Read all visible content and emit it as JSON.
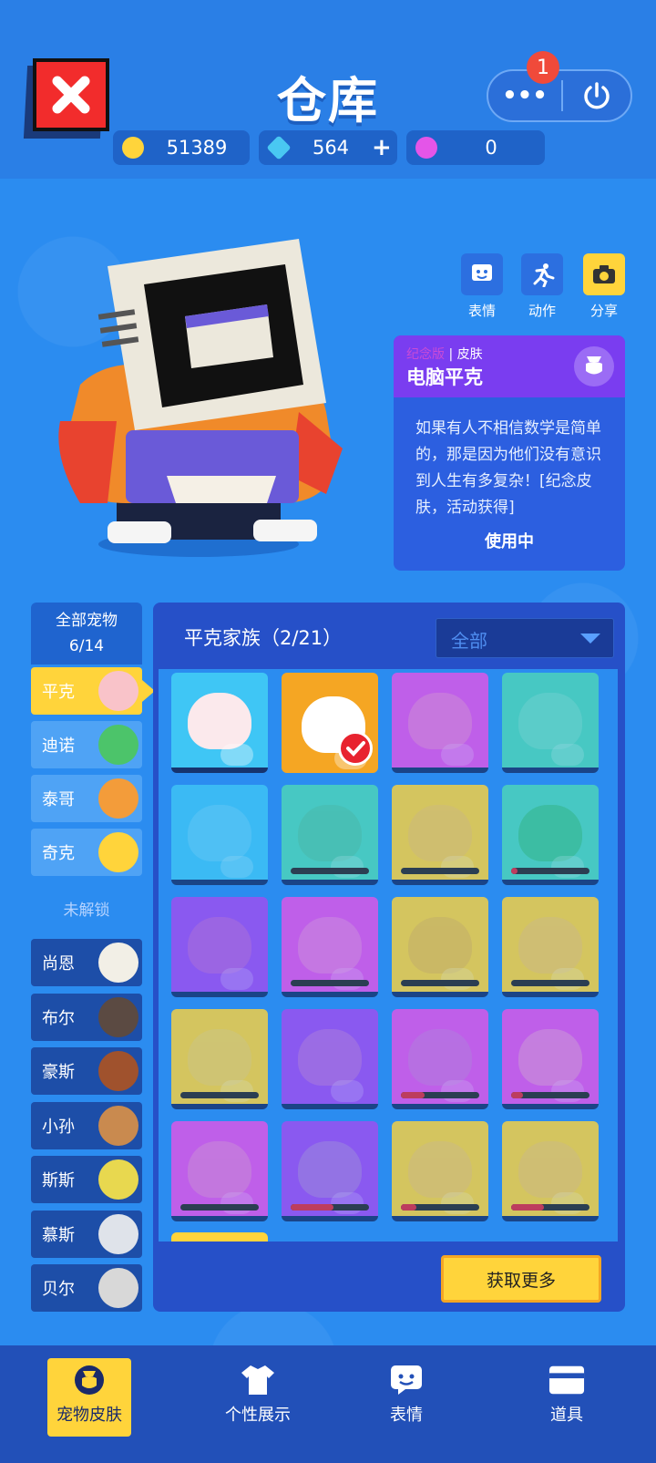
{
  "header": {
    "title": "仓库",
    "notification_count": "1",
    "more_label": "•••"
  },
  "resources": {
    "coins": "51389",
    "diamonds": "564",
    "diamonds_add": "+",
    "tokens": "0"
  },
  "actions": [
    {
      "label": "表情",
      "icon": "emoji-icon"
    },
    {
      "label": "动作",
      "icon": "action-icon"
    },
    {
      "label": "分享",
      "icon": "camera-icon"
    }
  ],
  "skin_info": {
    "rarity": "纪念版",
    "separator": "|",
    "category": "皮肤",
    "name": "电脑平克",
    "description": "如果有人不相信数学是简单的，那是因为他们没有意识到人生有多复杂！[纪念皮肤，活动获得]",
    "status": "使用中"
  },
  "pets": {
    "header_label": "全部宠物",
    "header_count": "6/14",
    "owned": [
      {
        "name": "平克",
        "color": "#ffd43b",
        "face": "#f9c3c9",
        "selected": true
      },
      {
        "name": "迪诺",
        "color": "#4fa3f5",
        "face": "#4cc46a",
        "selected": false
      },
      {
        "name": "泰哥",
        "color": "#4fa3f5",
        "face": "#f39c3a",
        "selected": false
      },
      {
        "name": "奇克",
        "color": "#4fa3f5",
        "face": "#ffd43b",
        "selected": false
      }
    ],
    "locked_label": "未解锁",
    "locked": [
      {
        "name": "尚恩",
        "face": "#f2efe6"
      },
      {
        "name": "布尔",
        "face": "#5b4a42"
      },
      {
        "name": "豪斯",
        "face": "#a0522d"
      },
      {
        "name": "小孙",
        "face": "#c98a4f"
      },
      {
        "name": "斯斯",
        "face": "#e8d84f"
      },
      {
        "name": "慕斯",
        "face": "#dfe3ea"
      },
      {
        "name": "贝尔",
        "face": "#d8d8d8"
      }
    ]
  },
  "grid": {
    "title": "平克家族（2/21）",
    "filter": "全部",
    "get_more": "获取更多",
    "skins": [
      {
        "bg": "#3fc6f5",
        "pig": "#fbe9ec",
        "owned": true,
        "selected": false,
        "progress": null
      },
      {
        "bg": "#f5a623",
        "pig": "#ffffff",
        "owned": true,
        "selected": true,
        "progress": null
      },
      {
        "bg": "#e455e8",
        "pig": "#f58bd0",
        "owned": false,
        "selected": false,
        "progress": null
      },
      {
        "bg": "#4fd8b8",
        "pig": "#7ee0c8",
        "owned": false,
        "selected": false,
        "progress": null
      },
      {
        "bg": "#3fc6f5",
        "pig": "#6fd6f5",
        "owned": false,
        "selected": false,
        "progress": null
      },
      {
        "bg": "#4fd8b8",
        "pig": "#52c49a",
        "owned": false,
        "selected": false,
        "progress": 0
      },
      {
        "bg": "#ffd43b",
        "pig": "#f5c462",
        "owned": false,
        "selected": false,
        "progress": 0
      },
      {
        "bg": "#4fd8b8",
        "pig": "#36c070",
        "owned": false,
        "selected": false,
        "progress": 0.08
      },
      {
        "bg": "#a24df0",
        "pig": "#c96ad6",
        "owned": false,
        "selected": false,
        "progress": null
      },
      {
        "bg": "#e455e8",
        "pig": "#f38bd8",
        "owned": false,
        "selected": false,
        "progress": 0
      },
      {
        "bg": "#ffd43b",
        "pig": "#e8b84a",
        "owned": false,
        "selected": false,
        "progress": 0
      },
      {
        "bg": "#ffd43b",
        "pig": "#f3c46a",
        "owned": false,
        "selected": false,
        "progress": 0
      },
      {
        "bg": "#ffd43b",
        "pig": "#f3d36a",
        "owned": false,
        "selected": false,
        "progress": 0
      },
      {
        "bg": "#a24df0",
        "pig": "#c97ad8",
        "owned": false,
        "selected": false,
        "progress": null
      },
      {
        "bg": "#e455e8",
        "pig": "#d37ad8",
        "owned": false,
        "selected": false,
        "progress": 0.3
      },
      {
        "bg": "#e455e8",
        "pig": "#f39ad0",
        "owned": false,
        "selected": false,
        "progress": 0.15
      },
      {
        "bg": "#e455e8",
        "pig": "#f08bd0",
        "owned": false,
        "selected": false,
        "progress": 0
      },
      {
        "bg": "#a24df0",
        "pig": "#b88ad8",
        "owned": false,
        "selected": false,
        "progress": 0.55
      },
      {
        "bg": "#ffd43b",
        "pig": "#f3c46a",
        "owned": false,
        "selected": false,
        "progress": 0.2
      },
      {
        "bg": "#ffd43b",
        "pig": "#f3c46a",
        "owned": false,
        "selected": false,
        "progress": 0.42
      }
    ]
  },
  "nav": [
    {
      "label": "宠物皮肤",
      "icon": "pet-skin-icon",
      "active": true
    },
    {
      "label": "个性展示",
      "icon": "tshirt-icon",
      "active": false
    },
    {
      "label": "表情",
      "icon": "emoji-icon",
      "active": false
    },
    {
      "label": "道具",
      "icon": "card-icon",
      "active": false
    }
  ],
  "colors": {
    "background": "#2b8cf0",
    "accent_yellow": "#ffd43b",
    "close_red": "#f22c2c",
    "card_purple": "#7a3df0"
  }
}
